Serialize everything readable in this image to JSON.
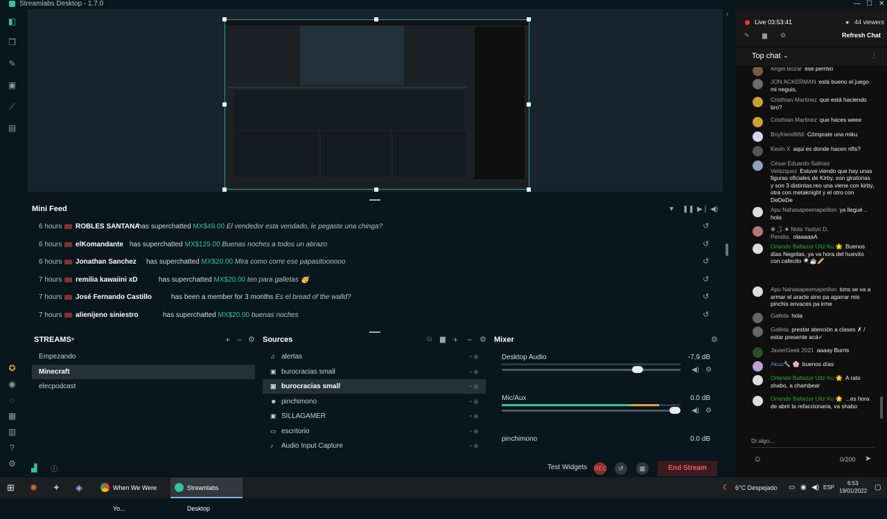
{
  "window": {
    "title": "Streamlabs Desktop - 1.7.0"
  },
  "minifeed": {
    "title": "Mini Feed",
    "rows": [
      {
        "time": "6 hours",
        "user": "ROBLES SANTANA",
        "action": "has superchatted",
        "amount": "MX$49.00",
        "message": "El vendedor esta vendado, le pegaste una chinga?"
      },
      {
        "time": "6 hours",
        "user": "elKomandante",
        "action": "has superchatted",
        "amount": "MX$129.00",
        "message": "Buenas noches a todos un abrazo"
      },
      {
        "time": "6 hours",
        "user": "Jonathan Sanchez",
        "action": "has superchatted",
        "amount": "MX$20.00",
        "message": "Mira como corre ese papasitoooooo"
      },
      {
        "time": "7 hours",
        "user": "remilia kawaiini xD",
        "action": "has superchatted",
        "amount": "MX$20.00",
        "message": "ten para galletas 🥳"
      },
      {
        "time": "7 hours",
        "user": "José Fernando Castillo",
        "action": "has been a member for 3 months",
        "amount": "",
        "message": "Es el bread of the walld?"
      },
      {
        "time": "7 hours",
        "user": "alienijeno siniestro",
        "action": "has superchatted",
        "amount": "MX$20.00",
        "message": "buenas noches"
      }
    ]
  },
  "streams": {
    "title": "STREAMS",
    "items": [
      {
        "label": "Empezando",
        "selected": false
      },
      {
        "label": "Minecraft",
        "selected": true
      },
      {
        "label": "elecpodcast",
        "selected": false
      }
    ]
  },
  "sources": {
    "title": "Sources",
    "items": [
      {
        "label": "alertas",
        "icon": "bell",
        "selected": false
      },
      {
        "label": "burocracias small",
        "icon": "image",
        "selected": false
      },
      {
        "label": "burocracias small",
        "icon": "image",
        "selected": true
      },
      {
        "label": "pinchimono",
        "icon": "user",
        "selected": false
      },
      {
        "label": "SILLAGAMER",
        "icon": "image",
        "selected": false
      },
      {
        "label": "escritorio",
        "icon": "monitor",
        "selected": false
      },
      {
        "label": "Audio Input Capture",
        "icon": "mic",
        "selected": false
      }
    ]
  },
  "mixer": {
    "title": "Mixer",
    "channels": [
      {
        "name": "Desktop Audio",
        "db": "-7.9 dB",
        "level": 0.0,
        "volume": 0.79
      },
      {
        "name": "Mic/Aux",
        "db": "0.0 dB",
        "level": 0.88,
        "volume": 1.0
      },
      {
        "name": "pinchimono",
        "db": "0.0 dB",
        "level": 0.0,
        "volume": 1.0
      }
    ]
  },
  "bottombar": {
    "test_widgets": "Test Widgets",
    "rec": "REC",
    "end_stream": "End Stream"
  },
  "chat": {
    "live": "Live 03:53:41",
    "viewers": "44 viewers",
    "refresh": "Refresh Chat",
    "top_chat": "Top chat",
    "input_placeholder": "Di algo...",
    "counter": "0/200",
    "messages": [
      {
        "author": "Angel Bozar",
        "text": "ese permio",
        "color": "gray"
      },
      {
        "author": "JON ACKERMAN",
        "text": "está bueno el juego mi neguis,",
        "color": "gray"
      },
      {
        "author": "Cristhian Martinez",
        "text": "que está haciendo bro?",
        "color": "gray"
      },
      {
        "author": "Cristhian Martinez",
        "text": "que haces weee",
        "color": "gray"
      },
      {
        "author": "Boyfriend666",
        "text": "Cómprate una miku",
        "color": "gray"
      },
      {
        "author": "Kevin X",
        "text": "aqui es donde hacen nfts?",
        "color": "gray"
      },
      {
        "author": "César Eduardo Salinas Velázquez",
        "text": "Estuve viendo que hay unas figuras oficiales de Kirby, son giratorias y son 3 distintas.reo una viene con kirby, otra con metaknight y el otro con DeDeDe",
        "color": "gray"
      },
      {
        "author": "Apu Nahasapeemapetilon",
        "text": "ya llegué .. hola",
        "color": "gray"
      },
      {
        "author": "❀ ͜ ͡ ʟ ★ Nola Yaslyn D. Peralta.",
        "text": "olaaaaaA",
        "color": "gray"
      },
      {
        "author": "Orlando Baltazar Uitz Ku 🌟",
        "text": "Buenos días Negotas, ya va hora del huevito con cafecito 🍳☕🥖",
        "color": "green"
      },
      {
        "author": "Apu Nahasapeemapetilon",
        "text": "tons se va a armar el aracle sino pa agarrar mis pinchis envaces pa irme",
        "color": "gray"
      },
      {
        "author": "Galleta",
        "text": "hola",
        "color": "gray"
      },
      {
        "author": "Galleta",
        "text": "prestar atención a clases ✗ / estar presente acá✓",
        "color": "gray"
      },
      {
        "author": "JavierGeek 2021",
        "text": "aaaay Burris",
        "color": "gray"
      },
      {
        "author": "Akuu🔧 🌸",
        "text": "buenos días",
        "color": "blue"
      },
      {
        "author": "Orlando Baltazar Uitz Ku 🌟",
        "text": "A rato shabo, a chambear",
        "color": "green"
      },
      {
        "author": "Orlando Baltazar Uitz Ku 🌟",
        "text": "...es hora de abrir la refaccionaria, va shabo",
        "color": "green"
      }
    ]
  },
  "taskbar": {
    "apps": [
      {
        "label": "When We Were Yo...",
        "active": false
      },
      {
        "label": "Streamlabs Desktop",
        "active": true
      }
    ],
    "weather": "6°C Despejado",
    "lang": "ESP",
    "time": "6:53",
    "date": "19/01/2022"
  },
  "colors": {
    "accent": "#31c3a2",
    "danger": "#f05a62",
    "bg": "#09161d"
  }
}
